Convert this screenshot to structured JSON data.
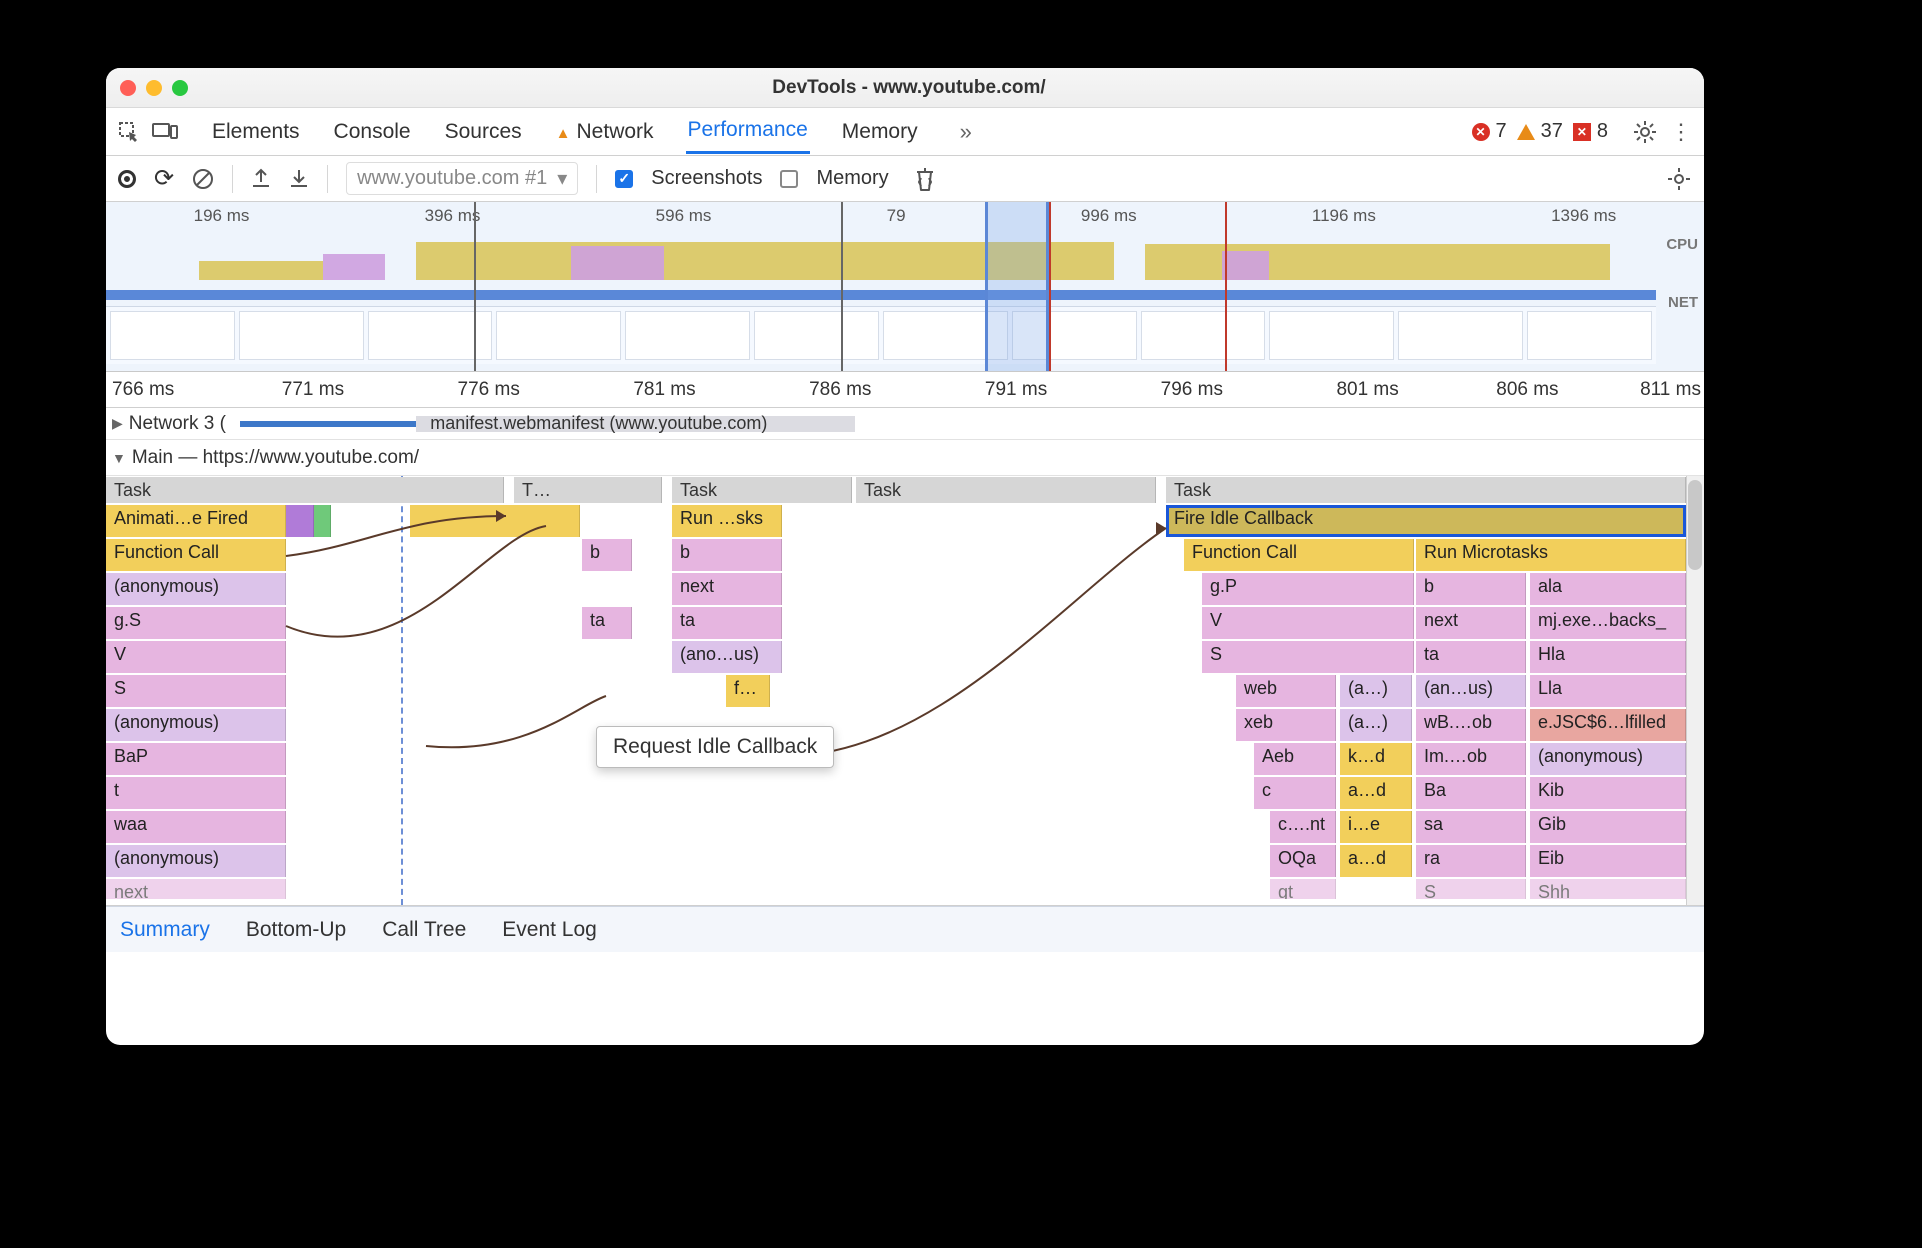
{
  "titlebar": {
    "title": "DevTools - www.youtube.com/"
  },
  "tabs": {
    "elements": "Elements",
    "console": "Console",
    "sources": "Sources",
    "network": "Network",
    "performance": "Performance",
    "memory": "Memory"
  },
  "errors": {
    "err_count": "7",
    "warn_count": "37",
    "block_count": "8"
  },
  "toolbar": {
    "dropdown": "www.youtube.com #1",
    "screenshots_label": "Screenshots",
    "memory_label": "Memory"
  },
  "overview": {
    "ticks": [
      "196 ms",
      "396 ms",
      "596 ms",
      "79",
      "996 ms",
      "1196 ms",
      "1396 ms"
    ],
    "overlay_tick": "ms",
    "cpu_label": "CPU",
    "net_label": "NET"
  },
  "ruler": [
    "766 ms",
    "771 ms",
    "776 ms",
    "781 ms",
    "786 ms",
    "791 ms",
    "796 ms",
    "801 ms",
    "806 ms",
    "811 ms"
  ],
  "tracks": {
    "network": "Network  3 (",
    "network_item": "manifest.webmanifest (www.youtube.com)",
    "main": "Main — https://www.youtube.com/"
  },
  "flame": {
    "tasks": [
      "Task",
      "T…",
      "Task",
      "Task",
      "Task"
    ],
    "selected": "Fire Idle Callback",
    "tooltip": "Request Idle Callback",
    "left_stack": [
      "Animati…e Fired",
      "Function Call",
      "(anonymous)",
      "g.S",
      "V",
      "S",
      "(anonymous)",
      "BaP",
      "t",
      "waa",
      "(anonymous)",
      "next"
    ],
    "mid_col": [
      "b",
      "ta"
    ],
    "mid2_col": [
      "Run …sks",
      "b",
      "next",
      "ta",
      "(ano…us)",
      "f…"
    ],
    "right_major": [
      "Function Call",
      "g.P",
      "V",
      "S"
    ],
    "right_sub1": [
      "web",
      "xeb",
      "Aeb",
      "c",
      "c….nt",
      "OQa",
      "gt"
    ],
    "right_sub2": [
      "(a…)",
      "(a…)",
      "k…d",
      "a…d",
      "i…e",
      "a…d"
    ],
    "right_sub3_head": "Run Microtasks",
    "right_sub3_a": [
      "b",
      "next",
      "ta",
      "(an…us)",
      "wB.…ob",
      "Im.…ob",
      "Ba",
      "sa",
      "ra",
      "S"
    ],
    "right_sub3_b": [
      "ala",
      "mj.exe…backs_",
      "Hla",
      "Lla",
      "e.JSC$6…lfilled",
      "(anonymous)",
      "Kib",
      "Gib",
      "Eib",
      "Shh"
    ]
  },
  "bottom_tabs": {
    "summary": "Summary",
    "bottom_up": "Bottom-Up",
    "call_tree": "Call Tree",
    "event_log": "Event Log"
  }
}
